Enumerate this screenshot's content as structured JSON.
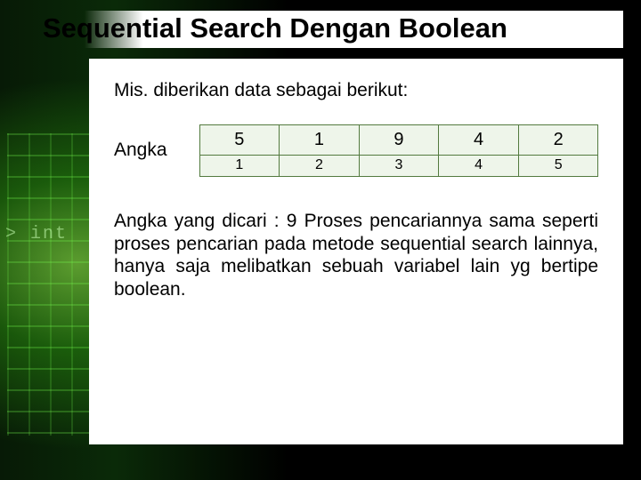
{
  "title": "Sequential Search Dengan Boolean",
  "intro": "Mis. diberikan data sebagai berikut:",
  "table": {
    "label": "Angka",
    "values": [
      "5",
      "1",
      "9",
      "4",
      "2"
    ],
    "indices": [
      "1",
      "2",
      "3",
      "4",
      "5"
    ]
  },
  "body": "Angka yang dicari : 9\nProses pencariannya sama seperti proses pencarian pada metode sequential search lainnya, hanya saja melibatkan sebuah variabel lain yg bertipe boolean."
}
